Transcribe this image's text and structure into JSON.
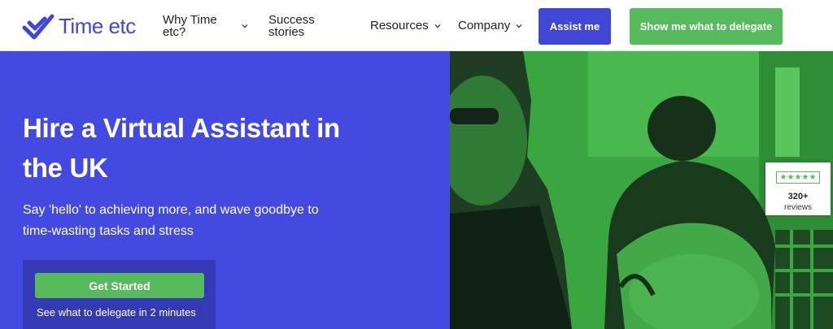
{
  "header": {
    "logo_text": "Time etc",
    "nav": {
      "why": "Why Time etc?",
      "success": "Success stories",
      "resources": "Resources",
      "company": "Company"
    },
    "assist_button": "Assist me",
    "delegate_button": "Show me what to delegate"
  },
  "hero": {
    "title": "Hire a Virtual Assistant in the UK",
    "subtitle": "Say 'hello' to achieving more, and wave goodbye to time-wasting tasks and stress",
    "cta_button": "Get Started",
    "cta_note": "See what to delegate in 2 minutes"
  },
  "reviews": {
    "stars": 5,
    "count": "320+",
    "label": "reviews"
  },
  "colors": {
    "brand_blue": "#4449e0",
    "brand_green": "#57ba5c",
    "photo_tint": "#39aa3f"
  },
  "icons": {
    "logo": "checkmark-logo-icon",
    "dropdown": "chevron-down-icon",
    "rating": "star-icon"
  }
}
